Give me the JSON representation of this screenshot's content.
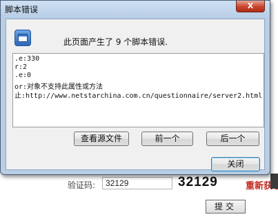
{
  "window": {
    "title": "脚本错误",
    "close_glyph": "X",
    "message": "此页面产生了 9 个脚本错误.",
    "details": [
      ".e:330",
      "r:2",
      ".e:0",
      "or:对象不支持此属性或方法",
      "止:http://www.netstarchina.com.cn/questionnaire/server2.html"
    ],
    "buttons": {
      "view_source": "查看源文件",
      "previous": "前一个",
      "next": "后一个",
      "close": "关闭"
    }
  },
  "page": {
    "captcha_label": "验证码:",
    "captcha_input_value": "32129",
    "captcha_code": "32129",
    "refresh_link": "重新获取",
    "submit_label": "提交"
  }
}
